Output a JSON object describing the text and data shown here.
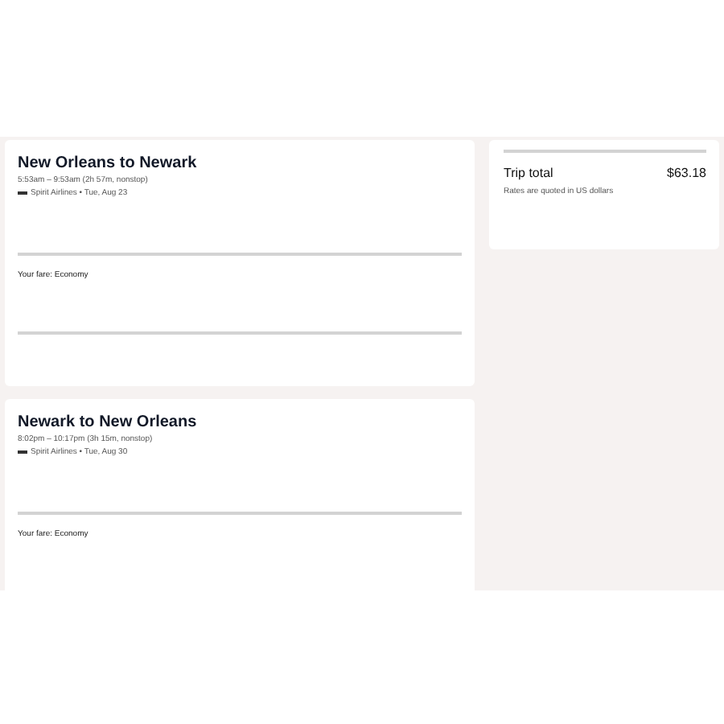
{
  "flights": [
    {
      "title": "New Orleans to Newark",
      "times": "5:53am – 9:53am (2h 57m, nonstop)",
      "carrier": "Spirit Airlines • Tue, Aug 23",
      "fare": "Your fare: Economy"
    },
    {
      "title": "Newark to New Orleans",
      "times": "8:02pm – 10:17pm (3h 15m, nonstop)",
      "carrier": "Spirit Airlines • Tue, Aug 30",
      "fare": "Your fare: Economy"
    }
  ],
  "summary": {
    "label": "Trip total",
    "amount": "$63.18",
    "note": "Rates are quoted in US dollars"
  }
}
